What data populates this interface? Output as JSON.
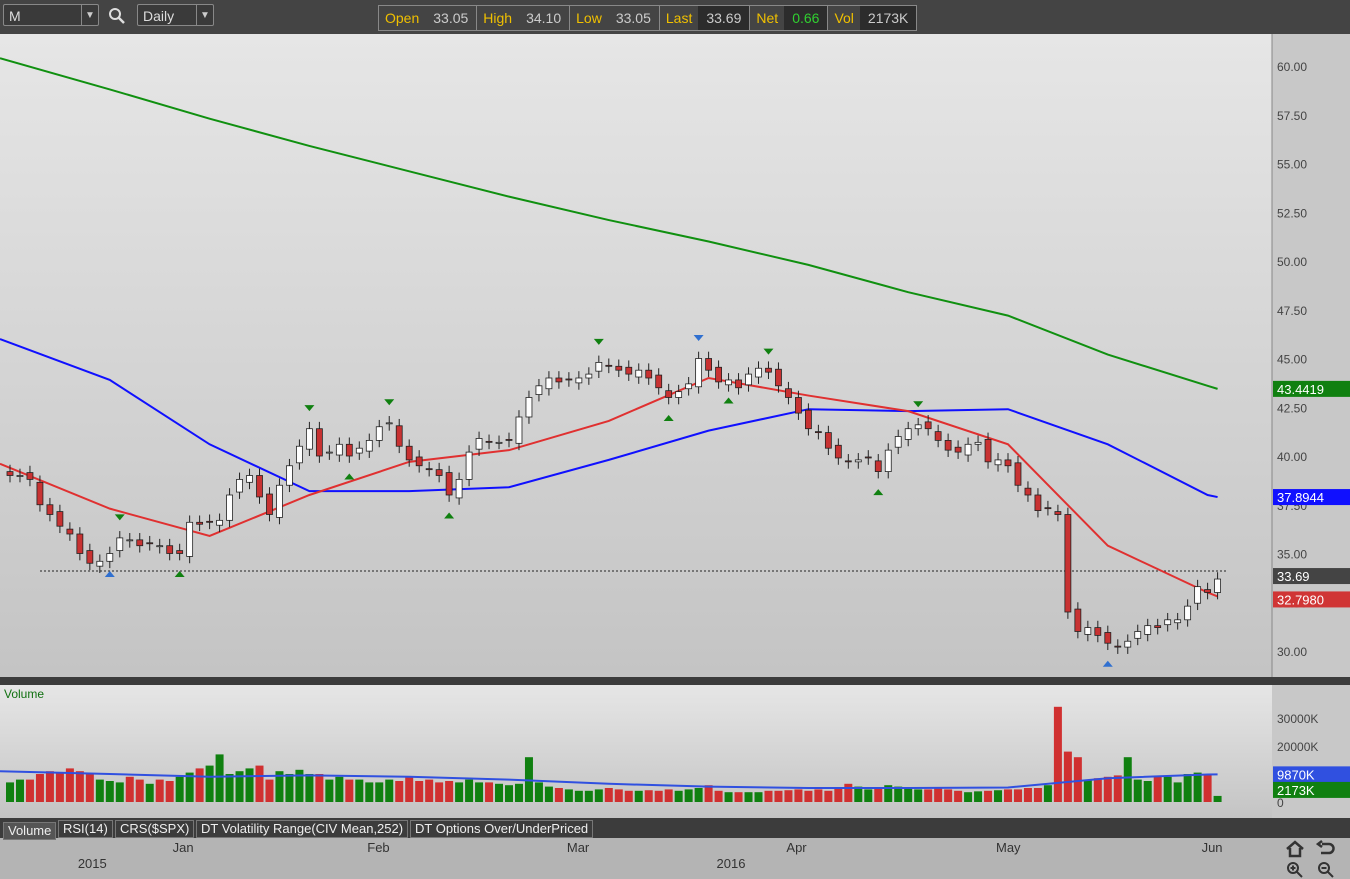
{
  "toolbar": {
    "symbol": "M",
    "interval": "Daily"
  },
  "quote": {
    "open_label": "Open",
    "open": "33.05",
    "high_label": "High",
    "high": "34.10",
    "low_label": "Low",
    "low": "33.05",
    "last_label": "Last",
    "last": "33.69",
    "net_label": "Net",
    "net": "0.66",
    "vol_label": "Vol",
    "vol": "2173K"
  },
  "colors": {
    "sma20": "#e03030",
    "sma50": "#1010ff",
    "sma200": "#109010",
    "up": "#ffffff",
    "down": "#c83232",
    "vol_up": "#108010",
    "vol_down": "#d03030"
  },
  "tabs": [
    "Volume",
    "RSI(14)",
    "CRS($SPX)",
    "DT Volatility Range(CIV Mean,252)",
    "DT Options Over/UnderPriced"
  ],
  "chart_data": {
    "type": "candlestick",
    "ylim": [
      29,
      62
    ],
    "yticks": [
      "60.00",
      "57.50",
      "55.00",
      "52.50",
      "50.00",
      "47.50",
      "45.00",
      "42.50",
      "40.00",
      "37.50",
      "35.00",
      "32.50",
      "30.00"
    ],
    "ytick_values": [
      60,
      57.5,
      55,
      52.5,
      50,
      47.5,
      45,
      42.5,
      40,
      37.5,
      35,
      32.5,
      30
    ],
    "xlabels": [
      {
        "text": "2015",
        "index": 8,
        "row": 2
      },
      {
        "text": "Jan",
        "index": 17.5,
        "row": 1
      },
      {
        "text": "Feb",
        "index": 37,
        "row": 1
      },
      {
        "text": "Mar",
        "index": 57,
        "row": 1
      },
      {
        "text": "2016",
        "index": 72,
        "row": 2
      },
      {
        "text": "Apr",
        "index": 79,
        "row": 1
      },
      {
        "text": "May",
        "index": 100,
        "row": 1
      },
      {
        "text": "Jun",
        "index": 120.6,
        "row": 1
      }
    ],
    "close": [
      39.0,
      39.0,
      38.8,
      37.5,
      37.0,
      36.4,
      36.0,
      35.0,
      34.5,
      34.6,
      35.0,
      35.8,
      35.7,
      35.4,
      35.5,
      35.4,
      35.0,
      35.0,
      36.6,
      36.5,
      36.6,
      36.7,
      38.0,
      38.8,
      39.0,
      37.9,
      37.0,
      38.5,
      39.5,
      40.5,
      41.4,
      40.0,
      40.2,
      40.6,
      40.0,
      40.4,
      40.8,
      41.5,
      41.7,
      40.5,
      39.8,
      39.5,
      39.3,
      39.0,
      38.0,
      38.8,
      40.2,
      40.9,
      40.7,
      40.7,
      40.8,
      42.0,
      43.0,
      43.6,
      44.0,
      43.8,
      43.9,
      44.0,
      44.2,
      44.8,
      44.6,
      44.4,
      44.2,
      44.4,
      44.0,
      43.5,
      43.0,
      43.3,
      43.7,
      45.0,
      44.4,
      43.8,
      43.9,
      43.5,
      44.2,
      44.5,
      44.3,
      43.6,
      43.0,
      42.2,
      41.4,
      41.2,
      40.4,
      39.9,
      39.7,
      39.8,
      39.9,
      39.2,
      40.3,
      41.0,
      41.4,
      41.6,
      41.4,
      40.8,
      40.3,
      40.2,
      40.6,
      40.7,
      39.7,
      39.8,
      39.5,
      38.5,
      38.0,
      37.2,
      37.3,
      37.0,
      32.0,
      31.0,
      31.2,
      30.8,
      30.4,
      30.2,
      30.5,
      31.0,
      31.3,
      31.2,
      31.6,
      31.6,
      32.3,
      33.3,
      33.0,
      33.69
    ],
    "reference_line": 34.1,
    "series": [
      {
        "name": "SMA200",
        "sample_every": 10,
        "values": [
          60.4,
          58.8,
          57.3,
          55.9,
          54.6,
          53.3,
          52.1,
          51.0,
          49.8,
          48.4,
          47.2,
          45.2,
          43.6,
          43.4419
        ],
        "label": "43.4419"
      },
      {
        "name": "SMA50",
        "sample_every": 10,
        "values": [
          46.0,
          43.9,
          40.6,
          38.2,
          38.2,
          38.4,
          39.8,
          41.3,
          42.4,
          42.3,
          42.4,
          40.6,
          38.0,
          37.8944
        ],
        "label": "37.8944"
      },
      {
        "name": "SMA20",
        "sample_every": 10,
        "values": [
          39.6,
          37.3,
          35.9,
          38.0,
          39.7,
          40.3,
          41.8,
          44.0,
          43.1,
          42.3,
          40.6,
          35.4,
          33.0,
          32.798
        ],
        "label": "32.7980"
      }
    ],
    "last_label": "33.69",
    "markers": [
      {
        "index": 11,
        "type": "top"
      },
      {
        "index": 30,
        "type": "top"
      },
      {
        "index": 38,
        "type": "top"
      },
      {
        "index": 59,
        "type": "top"
      },
      {
        "index": 69,
        "type": "top-blue"
      },
      {
        "index": 76,
        "type": "top"
      },
      {
        "index": 91,
        "type": "top"
      },
      {
        "index": 10,
        "type": "bottom-blue"
      },
      {
        "index": 17,
        "type": "bottom"
      },
      {
        "index": 34,
        "type": "bottom"
      },
      {
        "index": 44,
        "type": "bottom"
      },
      {
        "index": 66,
        "type": "bottom"
      },
      {
        "index": 72,
        "type": "bottom"
      },
      {
        "index": 87,
        "type": "bottom"
      },
      {
        "index": 110,
        "type": "bottom-blue"
      }
    ],
    "volume": {
      "title": "Volume",
      "ylim": [
        0,
        36000
      ],
      "yticks": [
        "30000K",
        "20000K",
        "10000K",
        "0"
      ],
      "ytick_values": [
        30000,
        20000,
        10000,
        0
      ],
      "values": [
        7000,
        8000,
        8000,
        10000,
        11000,
        10500,
        12000,
        11000,
        10000,
        8000,
        7500,
        7000,
        9000,
        8000,
        6500,
        8000,
        7500,
        9000,
        10500,
        12000,
        13000,
        17000,
        10000,
        11000,
        12000,
        13000,
        8000,
        11000,
        10000,
        11500,
        10000,
        10000,
        8000,
        9000,
        8000,
        8000,
        7000,
        7000,
        8000,
        7500,
        9000,
        7500,
        8000,
        7000,
        7500,
        7000,
        8000,
        7000,
        7000,
        6500,
        6000,
        6500,
        16000,
        7000,
        5500,
        5000,
        4500,
        4000,
        4000,
        4500,
        5000,
        4500,
        4000,
        4000,
        4200,
        4000,
        4500,
        4000,
        4500,
        5000,
        6000,
        4000,
        3500,
        3500,
        3500,
        3500,
        4000,
        4000,
        4200,
        4500,
        4000,
        4500,
        4000,
        5000,
        6500,
        5500,
        4500,
        5000,
        6000,
        5500,
        5000,
        4500,
        4500,
        4800,
        4500,
        4000,
        3500,
        3800,
        4000,
        4200,
        4500,
        4500,
        5000,
        5000,
        6000,
        34000,
        18000,
        16000,
        8000,
        8500,
        9000,
        9500,
        16000,
        8000,
        7500,
        9000,
        9000,
        7000,
        10000,
        10500,
        10000,
        2173
      ],
      "avg": {
        "sample_every": 10,
        "values": [
          11000,
          10000,
          9000,
          9500,
          9000,
          8000,
          6500,
          5500,
          5000,
          5000,
          5200,
          8500,
          9800,
          9870
        ]
      },
      "avg_label": "9870K",
      "last_label": "2173K"
    }
  }
}
